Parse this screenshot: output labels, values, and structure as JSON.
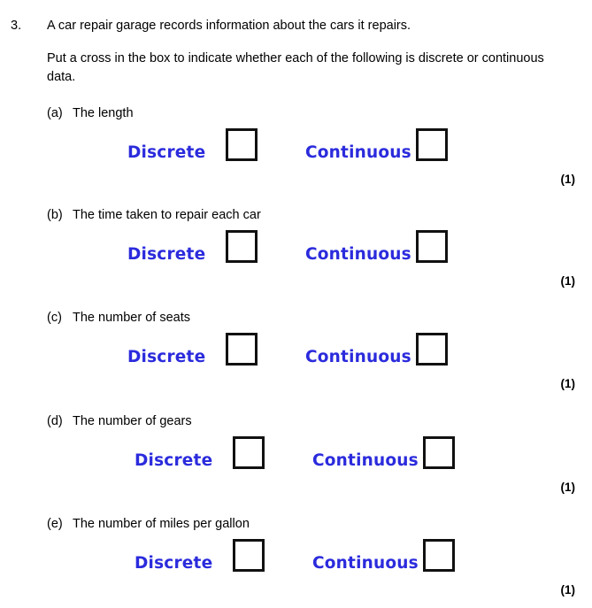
{
  "question": {
    "number": "3.",
    "stem": "A car repair garage records information about the cars it repairs.",
    "instruction": "Put a cross in the box to indicate whether each of the following is discrete or continuous data.",
    "option_labels": {
      "discrete": "Discrete",
      "continuous": "Continuous"
    },
    "marks_label": "(1)",
    "accent_color": "#2b2bdd",
    "parts": [
      {
        "letter": "(a)",
        "text": "The length",
        "marks": "(1)"
      },
      {
        "letter": "(b)",
        "text": "The time taken to repair each car",
        "marks": "(1)"
      },
      {
        "letter": "(c)",
        "text": "The number of seats",
        "marks": "(1)"
      },
      {
        "letter": "(d)",
        "text": "The number of gears",
        "marks": "(1)"
      },
      {
        "letter": "(e)",
        "text": "The number of miles per gallon",
        "marks": "(1)"
      }
    ]
  }
}
